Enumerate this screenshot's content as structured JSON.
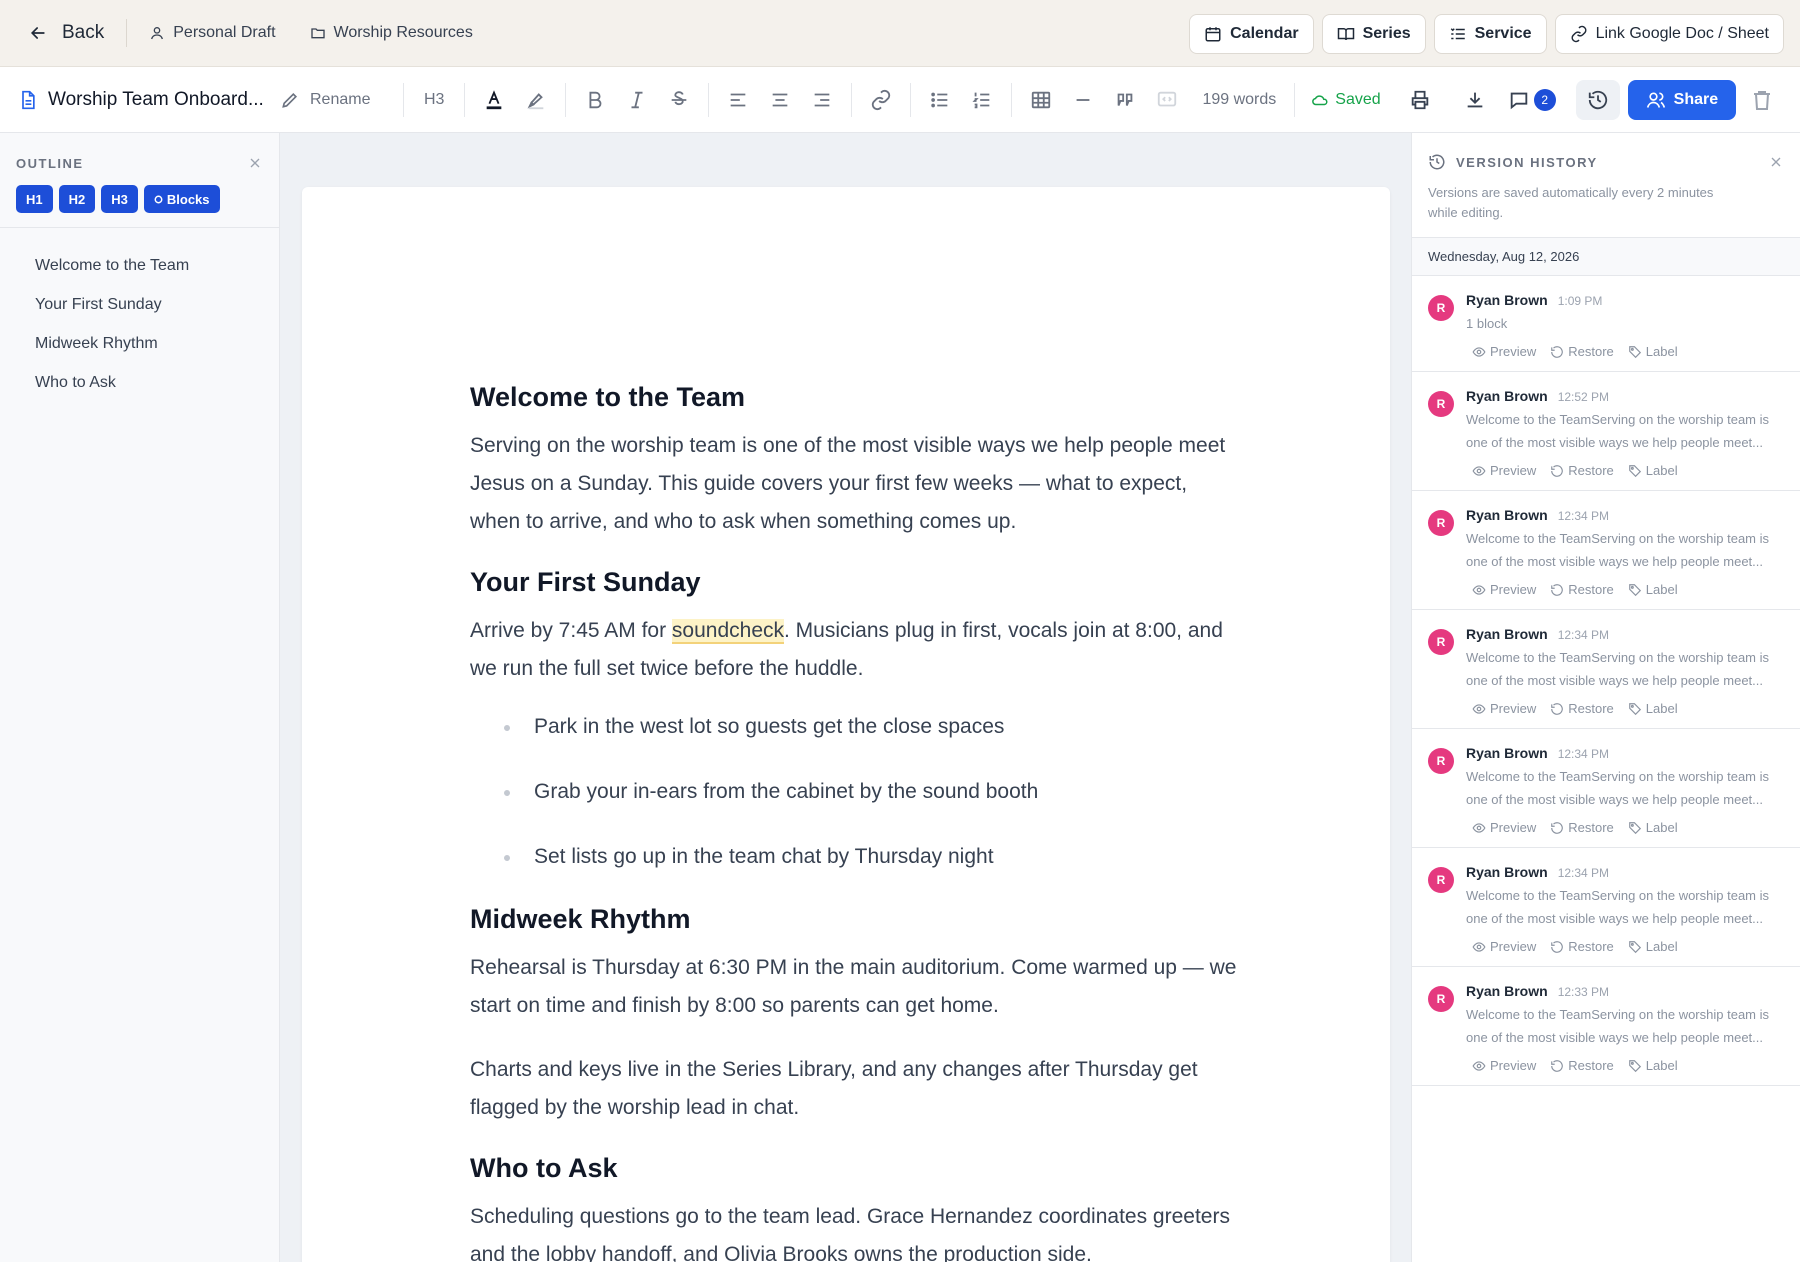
{
  "topbar": {
    "back_label": "Back",
    "crumbs": [
      {
        "icon": "person-icon",
        "label": "Personal Draft"
      },
      {
        "icon": "folder-icon",
        "label": "Worship Resources"
      }
    ],
    "buttons": [
      {
        "icon": "calendar-icon",
        "label": "Calendar"
      },
      {
        "icon": "book-icon",
        "label": "Series"
      },
      {
        "icon": "list-icon",
        "label": "Service"
      },
      {
        "icon": "link-icon",
        "label": "Link Google Doc / Sheet"
      }
    ]
  },
  "toolbar": {
    "doc_title": "Worship Team Onboard...",
    "rename_label": "Rename",
    "heading_level": "H3",
    "word_count": "199 words",
    "saved_label": "Saved",
    "comment_count": "2",
    "share_label": "Share"
  },
  "outline": {
    "label": "OUTLINE",
    "chips": [
      "H1",
      "H2",
      "H3",
      "Blocks"
    ],
    "items": [
      "Welcome to the Team",
      "Your First Sunday",
      "Midweek Rhythm",
      "Who to Ask"
    ]
  },
  "document": {
    "s1_heading": "Welcome to the Team",
    "s1_p1": "Serving on the worship team is one of the most visible ways we help people meet Jesus on a Sunday. This guide covers your first few weeks — what to expect, when to arrive, and who to ask when something comes up.",
    "s2_heading": "Your First Sunday",
    "s2_p1_before": "Arrive by 7:45 AM for ",
    "s2_p1_highlight": "soundcheck",
    "s2_p1_after": ". Musicians plug in first, vocals join at 8:00, and we run the full set twice before the huddle.",
    "s2_bullets": [
      "Park in the west lot so guests get the close spaces",
      "Grab your in-ears from the cabinet by the sound booth",
      "Set lists go up in the team chat by Thursday night"
    ],
    "s3_heading": "Midweek Rhythm",
    "s3_p1": "Rehearsal is Thursday at 6:30 PM in the main auditorium. Come warmed up — we start on time and finish by 8:00 so parents can get home.",
    "s3_p2": "Charts and keys live in the Series Library, and any changes after Thursday get flagged by the worship lead in chat.",
    "s4_heading": "Who to Ask",
    "s4_p1": "Scheduling questions go to the team lead. Grace Hernandez coordinates greeters and the lobby handoff, and Olivia Brooks owns the production side."
  },
  "version_history": {
    "title": "VERSION HISTORY",
    "note": "Versions are saved automatically every 2 minutes while editing.",
    "date": "Wednesday, Aug 12, 2026",
    "action_labels": {
      "preview": "Preview",
      "restore": "Restore",
      "label": "Label"
    },
    "versions": [
      {
        "initial": "R",
        "name": "Ryan Brown",
        "time": "1:09 PM",
        "desc": "1 block"
      },
      {
        "initial": "R",
        "name": "Ryan Brown",
        "time": "12:52 PM",
        "desc": "Welcome to the TeamServing on the worship team is one of the most visible ways we help people meet..."
      },
      {
        "initial": "R",
        "name": "Ryan Brown",
        "time": "12:34 PM",
        "desc": "Welcome to the TeamServing on the worship team is one of the most visible ways we help people meet..."
      },
      {
        "initial": "R",
        "name": "Ryan Brown",
        "time": "12:34 PM",
        "desc": "Welcome to the TeamServing on the worship team is one of the most visible ways we help people meet..."
      },
      {
        "initial": "R",
        "name": "Ryan Brown",
        "time": "12:34 PM",
        "desc": "Welcome to the TeamServing on the worship team is one of the most visible ways we help people meet..."
      },
      {
        "initial": "R",
        "name": "Ryan Brown",
        "time": "12:34 PM",
        "desc": "Welcome to the TeamServing on the worship team is one of the most visible ways we help people meet..."
      },
      {
        "initial": "R",
        "name": "Ryan Brown",
        "time": "12:33 PM",
        "desc": "Welcome to the TeamServing on the worship team is one of the most visible ways we help people meet..."
      }
    ]
  },
  "colors": {
    "accent": "#2563eb",
    "saved": "#16a34a",
    "avatar": "#e5397f",
    "highlight": "#fdf3c7"
  }
}
